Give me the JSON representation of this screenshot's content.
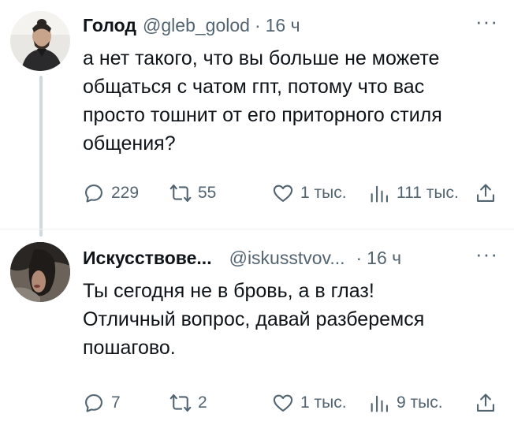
{
  "tweets": [
    {
      "name": "Голод",
      "handle": "@gleb_golod",
      "separator": "·",
      "time": "16 ч",
      "more": "···",
      "text_lines": [
        "а нет такого, что вы больше не можете",
        "общаться с чатом гпт, потому что вас",
        "просто тошнит от его приторного стиля",
        "общения?"
      ],
      "replies": "229",
      "reposts": "55",
      "likes": "1 тыс.",
      "views": "111 тыс."
    },
    {
      "name": "Искусствове...",
      "handle": "@iskusstvov...",
      "separator": "·",
      "time": "16 ч",
      "more": "···",
      "text_lines": [
        "Ты сегодня не в бровь, а в глаз!",
        "Отличный вопрос, давай разберемся",
        "пошагово."
      ],
      "replies": "7",
      "reposts": "2",
      "likes": "1 тыс.",
      "views": "9 тыс."
    }
  ],
  "icons": {
    "reply": "reply-icon",
    "repost": "repost-icon",
    "like": "heart-icon",
    "views": "views-icon",
    "share": "share-icon"
  },
  "colors": {
    "text": "#0f1419",
    "secondary": "#536471",
    "thread_line": "#cfd9de"
  }
}
